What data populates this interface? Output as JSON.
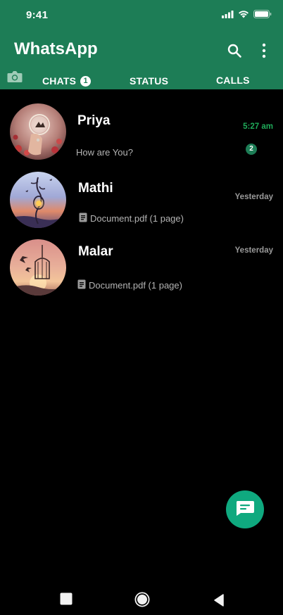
{
  "status_bar": {
    "time": "9:41"
  },
  "header": {
    "title": "WhatsApp",
    "icons": [
      "search-icon",
      "more-vert-icon"
    ]
  },
  "tabs": [
    {
      "label": "CHATS",
      "badge": "1",
      "selected": true
    },
    {
      "label": "STATUS"
    },
    {
      "label": "CALLS"
    }
  ],
  "chats": [
    {
      "name": "Priya",
      "preview": "How are You?",
      "time": "5:27 am",
      "unread": "2",
      "has_attachment": false
    },
    {
      "name": "Mathi",
      "preview": "Document.pdf (1 page)",
      "time": "Yesterday",
      "has_attachment": true
    },
    {
      "name": "Malar",
      "preview": "Document.pdf (1 page)",
      "time": "Yesterday",
      "has_attachment": true
    }
  ],
  "fab": {
    "icon": "new-chat-icon"
  },
  "nav": {
    "icons": [
      "recents-square-icon",
      "home-circle-icon",
      "back-triangle-icon"
    ]
  },
  "colors": {
    "header": "#1d7d56",
    "accent": "#1faa59",
    "fab": "#0fa97f",
    "background": "#000000"
  }
}
